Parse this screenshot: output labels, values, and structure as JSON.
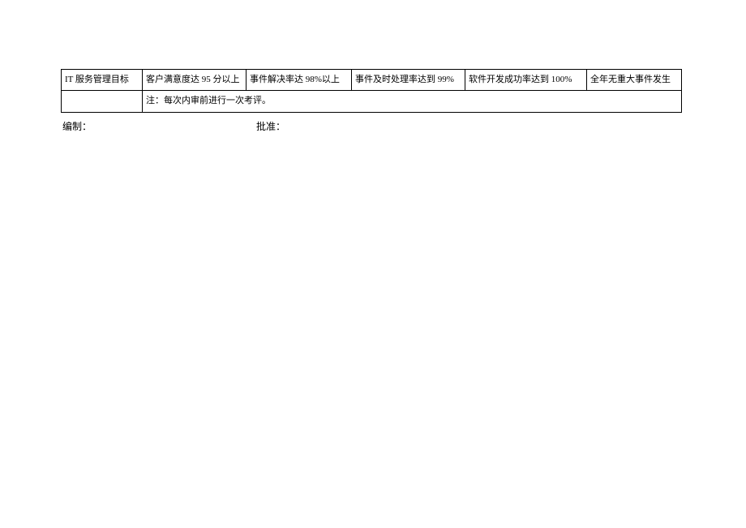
{
  "table": {
    "row1": {
      "c1": "IT 服务管理目标",
      "c2": "客户满意度达 95 分以上",
      "c3": "事件解决率达 98%以上",
      "c4": "事件及时处理率达到 99%",
      "c5": "软件开发成功率达到 100%",
      "c6": "全年无重大事件发生"
    },
    "row2": {
      "c1": "",
      "note": "注：每次内审前进行一次考评。"
    }
  },
  "footer": {
    "bianzhi": "编制：",
    "pizhun": "批准："
  }
}
